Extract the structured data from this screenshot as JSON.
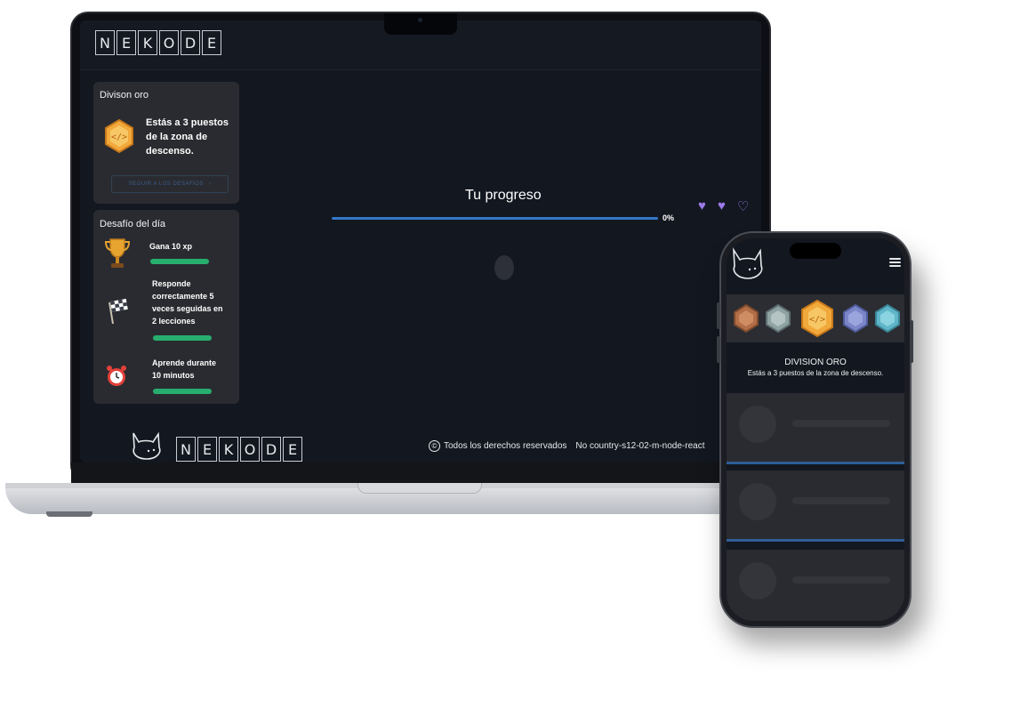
{
  "brand": {
    "letters": [
      "N",
      "E",
      "K",
      "O",
      "D",
      "E"
    ]
  },
  "division_card": {
    "title": "Divison oro",
    "message": "Estás a 3 puestos de la zona de descenso.",
    "button_label": "SEGUIR A LOS DESAFÍOS",
    "button_arrow": "›"
  },
  "challenges_card": {
    "title": "Desafío del día",
    "items": [
      {
        "label": "Gana 10 xp",
        "icon": "trophy-icon",
        "progress": 1.0
      },
      {
        "label": "Responde correctamente 5 veces seguidas en 2 lecciones",
        "icon": "checkered-flag-icon",
        "progress": 1.0
      },
      {
        "label": "Aprende durante 10 minutos",
        "icon": "alarm-clock-icon",
        "progress": 1.0
      }
    ]
  },
  "progress": {
    "title": "Tu progreso",
    "percent_label": "0%",
    "hearts": [
      "♥",
      "♥",
      "♡"
    ]
  },
  "footer": {
    "copyright_symbol": "©",
    "rights": "Todos los derechos reservados",
    "project": "No country-s12-02-m-node-react"
  },
  "phone": {
    "division_title": "DIVISION ORO",
    "division_sub": "Estás a 3 puestos de la zona de descenso.",
    "medals": [
      "bronze-medal-icon",
      "silver-medal-icon",
      "gold-medal-icon",
      "platinum-medal-icon",
      "diamond-medal-icon"
    ]
  },
  "colors": {
    "accent_blue": "#3478c8",
    "success_green": "#27ae6e",
    "heart_purple": "#9b7ae8",
    "gold": "#f2a93b"
  }
}
